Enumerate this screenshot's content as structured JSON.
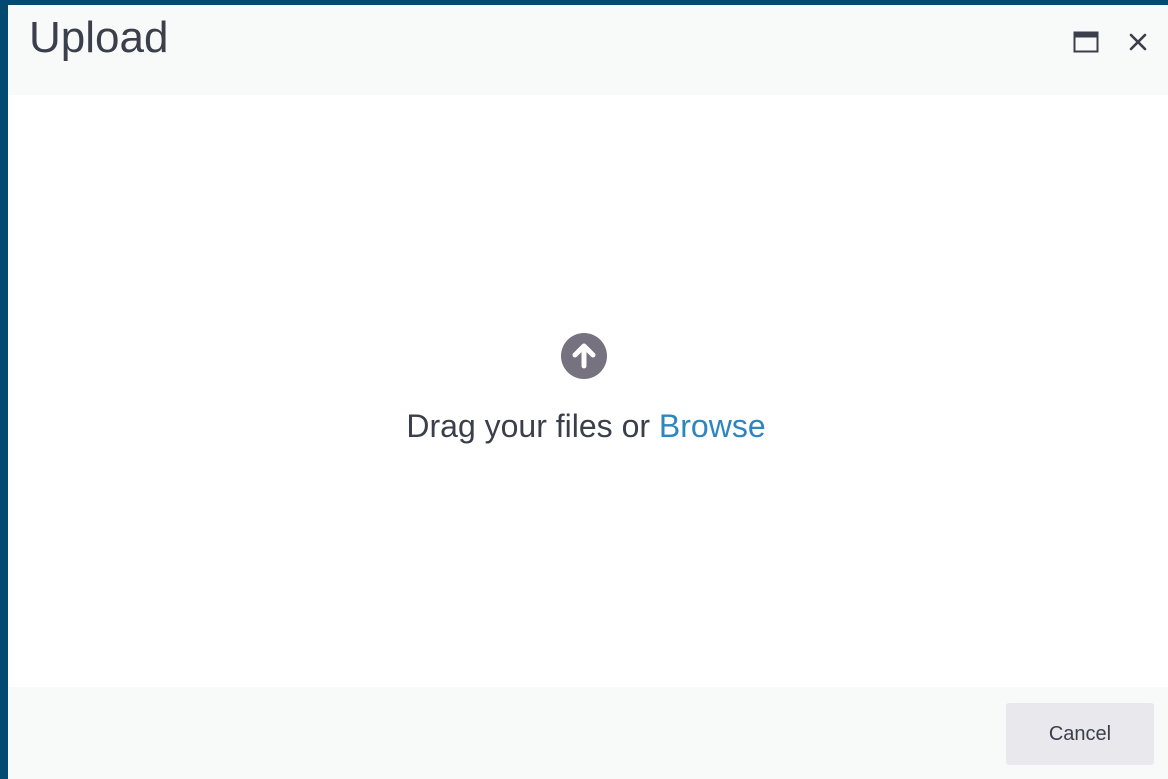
{
  "dialog": {
    "title": "Upload",
    "maximize_icon": "maximize-icon",
    "close_icon": "close-icon"
  },
  "dropzone": {
    "icon": "upload-arrow-icon",
    "prompt": "Drag your files or",
    "browse_label": "Browse"
  },
  "footer": {
    "cancel_label": "Cancel"
  },
  "colors": {
    "backdrop": "#034a72",
    "link": "#2e86c1",
    "text": "#3a3f4b",
    "icon": "#76727f"
  }
}
